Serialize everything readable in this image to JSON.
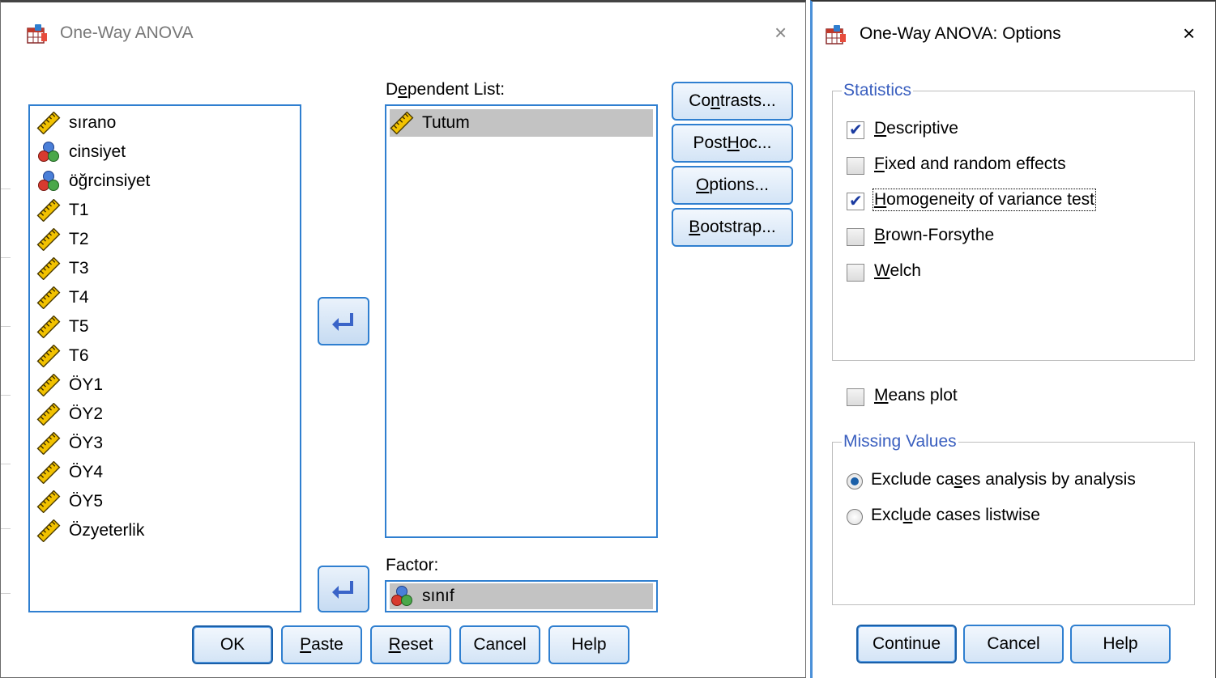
{
  "main_dialog": {
    "title": "One-Way ANOVA",
    "close_glyph": "×",
    "variables": [
      {
        "name": "sırano",
        "icon": "ruler-icon"
      },
      {
        "name": "cinsiyet",
        "icon": "nominal-icon"
      },
      {
        "name": "öğrcinsiyet",
        "icon": "nominal-icon"
      },
      {
        "name": "T1",
        "icon": "ruler-icon"
      },
      {
        "name": "T2",
        "icon": "ruler-icon"
      },
      {
        "name": "T3",
        "icon": "ruler-icon"
      },
      {
        "name": "T4",
        "icon": "ruler-icon"
      },
      {
        "name": "T5",
        "icon": "ruler-icon"
      },
      {
        "name": "T6",
        "icon": "ruler-icon"
      },
      {
        "name": "ÖY1",
        "icon": "ruler-icon"
      },
      {
        "name": "ÖY2",
        "icon": "ruler-icon"
      },
      {
        "name": "ÖY3",
        "icon": "ruler-icon"
      },
      {
        "name": "ÖY4",
        "icon": "ruler-icon"
      },
      {
        "name": "ÖY5",
        "icon": "ruler-icon"
      },
      {
        "name": "Özyeterlik",
        "icon": "ruler-icon"
      }
    ],
    "dependent_list": {
      "label_pre": "D",
      "label_ul": "e",
      "label_post": "pendent List:",
      "items": [
        {
          "name": "Tutum",
          "icon": "ruler-icon"
        }
      ]
    },
    "factor": {
      "label": "Factor:",
      "value": "sınıf",
      "icon": "nominal-icon"
    },
    "side_buttons": [
      {
        "pre": "Co",
        "ul": "n",
        "post": "trasts..."
      },
      {
        "pre": "Post ",
        "ul": "H",
        "post": "oc..."
      },
      {
        "pre": "",
        "ul": "O",
        "post": "ptions..."
      },
      {
        "pre": "",
        "ul": "B",
        "post": "ootstrap..."
      }
    ],
    "bottom_buttons": [
      {
        "pre": "OK",
        "ul": "",
        "post": ""
      },
      {
        "pre": "",
        "ul": "P",
        "post": "aste"
      },
      {
        "pre": "",
        "ul": "R",
        "post": "eset"
      },
      {
        "pre": "Cancel",
        "ul": "",
        "post": ""
      },
      {
        "pre": "Help",
        "ul": "",
        "post": ""
      }
    ]
  },
  "options_dialog": {
    "title": "One-Way ANOVA: Options",
    "close_glyph": "×",
    "statistics_group": "Statistics",
    "statistics": [
      {
        "pre": "",
        "ul": "D",
        "post": "escriptive",
        "checked": true
      },
      {
        "pre": "",
        "ul": "F",
        "post": "ixed and random effects",
        "checked": false
      },
      {
        "pre": "",
        "ul": "H",
        "post": "omogeneity of variance test",
        "checked": true
      },
      {
        "pre": "",
        "ul": "B",
        "post": "rown-Forsythe",
        "checked": false
      },
      {
        "pre": "",
        "ul": "W",
        "post": "elch",
        "checked": false
      }
    ],
    "means_plot": {
      "pre": "",
      "ul": "M",
      "post": "eans plot",
      "checked": false
    },
    "missing_group": "Missing Values",
    "missing": [
      {
        "pre": "Exclude ca",
        "ul": "s",
        "post": "es analysis by analysis",
        "selected": true
      },
      {
        "pre": "Excl",
        "ul": "u",
        "post": "de cases listwise",
        "selected": false
      }
    ],
    "buttons": [
      {
        "label": "Continue"
      },
      {
        "label": "Cancel"
      },
      {
        "label": "Help"
      }
    ],
    "check_glyph": "✔"
  }
}
